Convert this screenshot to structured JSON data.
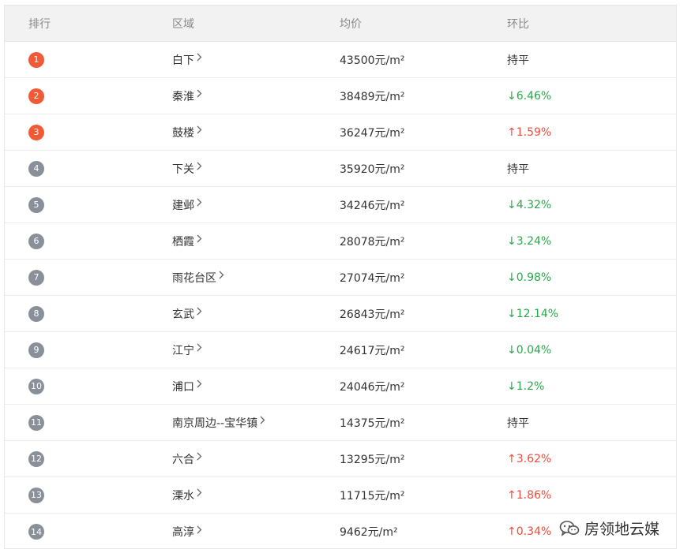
{
  "header": {
    "rank": "排行",
    "region": "区域",
    "price": "均价",
    "change": "环比"
  },
  "colors": {
    "top_rank": "#f05a36",
    "other_rank": "#8a9099",
    "up": "#f04b3a",
    "down": "#2aa84a",
    "flat": "#333333"
  },
  "rows": [
    {
      "rank": "1",
      "region": "白下",
      "price": "43500元/m²",
      "change": "持平",
      "trend": "flat"
    },
    {
      "rank": "2",
      "region": "秦淮",
      "price": "38489元/m²",
      "change": "↓6.46%",
      "trend": "down"
    },
    {
      "rank": "3",
      "region": "鼓楼",
      "price": "36247元/m²",
      "change": "↑1.59%",
      "trend": "up"
    },
    {
      "rank": "4",
      "region": "下关",
      "price": "35920元/m²",
      "change": "持平",
      "trend": "flat"
    },
    {
      "rank": "5",
      "region": "建邺",
      "price": "34246元/m²",
      "change": "↓4.32%",
      "trend": "down"
    },
    {
      "rank": "6",
      "region": "栖霞",
      "price": "28078元/m²",
      "change": "↓3.24%",
      "trend": "down"
    },
    {
      "rank": "7",
      "region": "雨花台区",
      "price": "27074元/m²",
      "change": "↓0.98%",
      "trend": "down"
    },
    {
      "rank": "8",
      "region": "玄武",
      "price": "26843元/m²",
      "change": "↓12.14%",
      "trend": "down"
    },
    {
      "rank": "9",
      "region": "江宁",
      "price": "24617元/m²",
      "change": "↓0.04%",
      "trend": "down"
    },
    {
      "rank": "10",
      "region": "浦口",
      "price": "24046元/m²",
      "change": "↓1.2%",
      "trend": "down"
    },
    {
      "rank": "11",
      "region": "南京周边--宝华镇",
      "price": "14375元/m²",
      "change": "持平",
      "trend": "flat"
    },
    {
      "rank": "12",
      "region": "六合",
      "price": "13295元/m²",
      "change": "↑3.62%",
      "trend": "up"
    },
    {
      "rank": "13",
      "region": "溧水",
      "price": "11715元/m²",
      "change": "↑1.86%",
      "trend": "up"
    },
    {
      "rank": "14",
      "region": "高淳",
      "price": "9462元/m²",
      "change": "↑0.34%",
      "trend": "up"
    }
  ],
  "chevron_icon": "chevron-right-icon",
  "watermark": {
    "text": "房领地云媒",
    "icon": "wechat-icon"
  }
}
